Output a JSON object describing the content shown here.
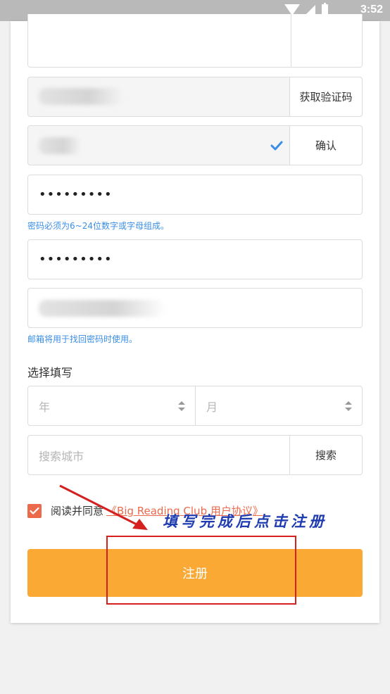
{
  "status_bar": {
    "time": "3:52"
  },
  "form": {
    "code_button": "获取验证码",
    "confirm_button": "确认",
    "password_value": "•••••••••",
    "password_hint": "密码必须为6~24位数字或字母组成。",
    "confirm_password_value": "•••••••••",
    "email_hint": "邮箱将用于找回密码时使用。",
    "optional_label": "选择填写",
    "year_placeholder": "年",
    "month_placeholder": "月",
    "city_placeholder": "搜索城市",
    "search_button": "搜索",
    "agree_text": "阅读并同意",
    "agree_link": "《Big Reading Club 用户协议》",
    "register_button": "注册"
  },
  "annotation": {
    "text": "填写完成后点击注册"
  },
  "colors": {
    "accent_orange": "#fba935",
    "hint_blue": "#3a8ee6",
    "checkbox_red": "#ec6a4c",
    "annotation_red": "#d4201f",
    "annotation_blue": "#1f3bb0"
  }
}
